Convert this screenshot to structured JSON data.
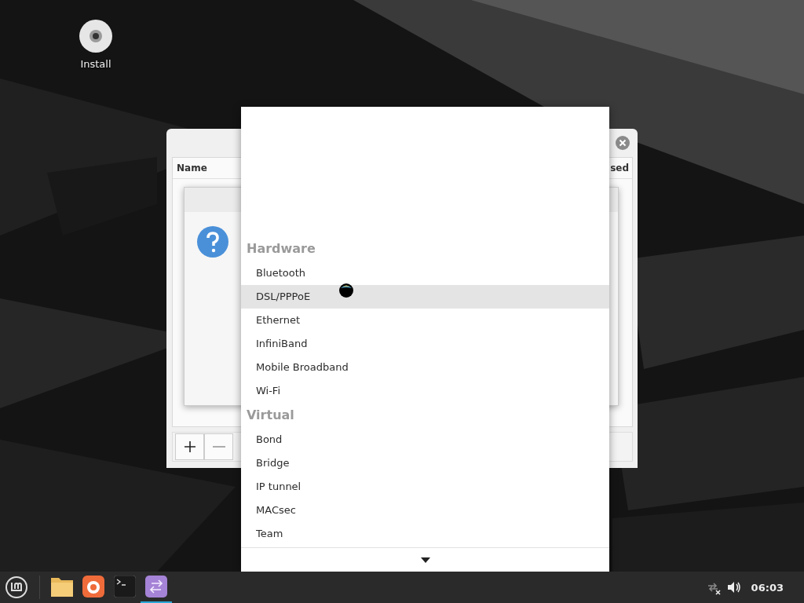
{
  "desktop": {
    "icons": [
      {
        "label": "Install"
      }
    ]
  },
  "window": {
    "columns": [
      {
        "label": "Name"
      },
      {
        "label": "sed"
      }
    ]
  },
  "menu": {
    "sections": [
      {
        "title": "Hardware",
        "items": [
          {
            "label": "Bluetooth",
            "selected": false
          },
          {
            "label": "DSL/PPPoE",
            "selected": true
          },
          {
            "label": "Ethernet",
            "selected": false
          },
          {
            "label": "InfiniBand",
            "selected": false
          },
          {
            "label": "Mobile Broadband",
            "selected": false
          },
          {
            "label": "Wi-Fi",
            "selected": false
          }
        ]
      },
      {
        "title": "Virtual",
        "items": [
          {
            "label": "Bond",
            "selected": false
          },
          {
            "label": "Bridge",
            "selected": false
          },
          {
            "label": "IP tunnel",
            "selected": false
          },
          {
            "label": "MACsec",
            "selected": false
          },
          {
            "label": "Team",
            "selected": false
          }
        ]
      }
    ]
  },
  "taskbar": {
    "launchers": [
      {
        "kind": "files",
        "active": false
      },
      {
        "kind": "browser",
        "active": false
      },
      {
        "kind": "terminal",
        "active": false
      },
      {
        "kind": "connections",
        "active": true
      }
    ],
    "clock": "06:03"
  }
}
